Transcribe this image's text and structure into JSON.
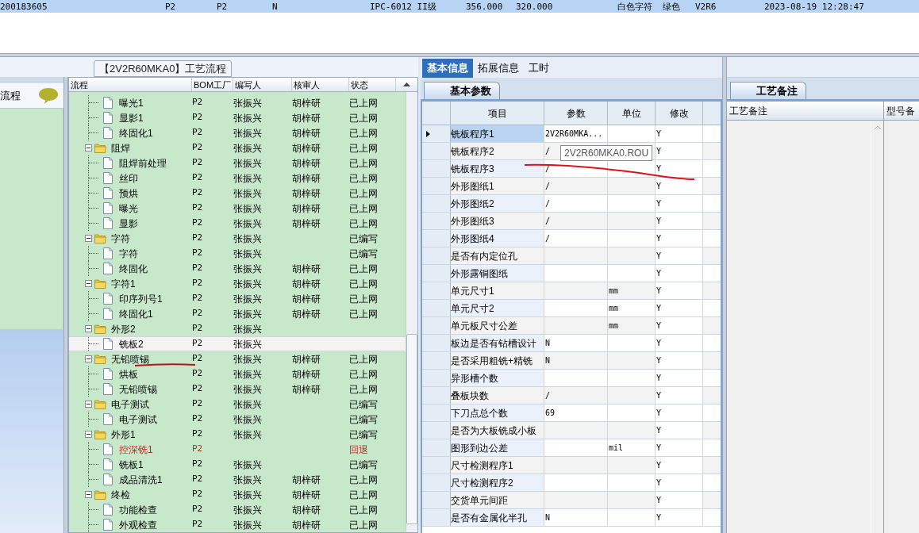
{
  "top_row": {
    "selected": true,
    "cells": [
      "200183605",
      "P2",
      "P2",
      "N",
      "IPC-6012 II级",
      "356.000",
      "320.000",
      "白色字符",
      "绿色",
      "V2R6",
      "2023-08-19 12:28:47"
    ]
  },
  "process_panel": {
    "title": "【2V2R60MKA0】工艺流程",
    "nav_item": "流程",
    "columns": [
      "流程",
      "BOM工厂",
      "编写人",
      "核审人",
      "状态"
    ],
    "groups": [
      {
        "children": [
          {
            "label": "曝光1",
            "factory": "P2",
            "writer": "张振兴",
            "reviewer": "胡梓研",
            "status": "已上网",
            "returned": false,
            "selected": false
          },
          {
            "label": "显影1",
            "factory": "P2",
            "writer": "张振兴",
            "reviewer": "胡梓研",
            "status": "已上网",
            "returned": false,
            "selected": false
          },
          {
            "label": "终固化1",
            "factory": "P2",
            "writer": "张振兴",
            "reviewer": "胡梓研",
            "status": "已上网",
            "returned": false,
            "selected": false
          }
        ]
      },
      {
        "label": "阻焊",
        "factory": "P2",
        "writer": "张振兴",
        "reviewer": "胡梓研",
        "status": "已上网",
        "expanded": true,
        "children": [
          {
            "label": "阻焊前处理",
            "factory": "P2",
            "writer": "张振兴",
            "reviewer": "胡梓研",
            "status": "已上网",
            "returned": false,
            "selected": false
          },
          {
            "label": "丝印",
            "factory": "P2",
            "writer": "张振兴",
            "reviewer": "胡梓研",
            "status": "已上网",
            "returned": false,
            "selected": false
          },
          {
            "label": "预烘",
            "factory": "P2",
            "writer": "张振兴",
            "reviewer": "胡梓研",
            "status": "已上网",
            "returned": false,
            "selected": false
          },
          {
            "label": "曝光",
            "factory": "P2",
            "writer": "张振兴",
            "reviewer": "胡梓研",
            "status": "已上网",
            "returned": false,
            "selected": false
          },
          {
            "label": "显影",
            "factory": "P2",
            "writer": "张振兴",
            "reviewer": "胡梓研",
            "status": "已上网",
            "returned": false,
            "selected": false
          }
        ]
      },
      {
        "label": "字符",
        "factory": "P2",
        "writer": "张振兴",
        "status": "已编写",
        "expanded": true,
        "children": [
          {
            "label": "字符",
            "factory": "P2",
            "writer": "张振兴",
            "status": "已编写",
            "returned": false,
            "selected": false
          },
          {
            "label": "终固化",
            "factory": "P2",
            "writer": "张振兴",
            "reviewer": "胡梓研",
            "status": "已上网",
            "returned": false,
            "selected": false
          }
        ]
      },
      {
        "label": "字符1",
        "factory": "P2",
        "writer": "张振兴",
        "reviewer": "胡梓研",
        "status": "已上网",
        "expanded": true,
        "children": [
          {
            "label": "印序列号1",
            "factory": "P2",
            "writer": "张振兴",
            "reviewer": "胡梓研",
            "status": "已上网",
            "returned": false,
            "selected": false
          },
          {
            "label": "终固化1",
            "factory": "P2",
            "writer": "张振兴",
            "reviewer": "胡梓研",
            "status": "已上网",
            "returned": false,
            "selected": false
          }
        ]
      },
      {
        "label": "外形2",
        "factory": "P2",
        "writer": "张振兴",
        "expanded": true,
        "children": [
          {
            "label": "铣板2",
            "factory": "P2",
            "writer": "张振兴",
            "returned": false,
            "selected": true
          }
        ]
      },
      {
        "label": "无铅喷锡",
        "factory": "P2",
        "writer": "张振兴",
        "reviewer": "胡梓研",
        "status": "已上网",
        "expanded": true,
        "children": [
          {
            "label": "烘板",
            "factory": "P2",
            "writer": "张振兴",
            "reviewer": "胡梓研",
            "status": "已上网",
            "returned": false,
            "selected": false
          },
          {
            "label": "无铅喷锡",
            "factory": "P2",
            "writer": "张振兴",
            "reviewer": "胡梓研",
            "status": "已上网",
            "returned": false,
            "selected": false
          }
        ]
      },
      {
        "label": "电子测试",
        "factory": "P2",
        "writer": "张振兴",
        "status": "已编写",
        "expanded": true,
        "children": [
          {
            "label": "电子测试",
            "factory": "P2",
            "writer": "张振兴",
            "status": "已编写",
            "returned": false,
            "selected": false
          }
        ]
      },
      {
        "label": "外形1",
        "factory": "P2",
        "writer": "张振兴",
        "status": "已编写",
        "expanded": true,
        "children": [
          {
            "label": "控深铣1",
            "factory": "P2",
            "status": "回退",
            "returned": true,
            "selected": false
          },
          {
            "label": "铣板1",
            "factory": "P2",
            "writer": "张振兴",
            "status": "已编写",
            "returned": false,
            "selected": false
          },
          {
            "label": "成品清洗1",
            "factory": "P2",
            "writer": "张振兴",
            "reviewer": "胡梓研",
            "status": "已上网",
            "returned": false,
            "selected": false
          }
        ]
      },
      {
        "label": "终检",
        "factory": "P2",
        "writer": "张振兴",
        "reviewer": "胡梓研",
        "status": "已上网",
        "expanded": true,
        "children": [
          {
            "label": "功能检查",
            "factory": "P2",
            "writer": "张振兴",
            "reviewer": "胡梓研",
            "status": "已上网",
            "returned": false,
            "selected": false
          },
          {
            "label": "外观检查",
            "factory": "P2",
            "writer": "张振兴",
            "reviewer": "胡梓研",
            "status": "已上网",
            "returned": false,
            "selected": false
          }
        ]
      }
    ]
  },
  "detail": {
    "tabs": [
      {
        "label": "基本信息",
        "selected": true
      },
      {
        "label": "拓展信息",
        "selected": false
      },
      {
        "label": "工时",
        "selected": false
      }
    ],
    "subtab": "基本参数",
    "columns": [
      "项目",
      "参数",
      "单位",
      "修改"
    ],
    "tooltip": "2V2R60MKA0.ROU",
    "rows": [
      {
        "item": "铣板程序1",
        "param": "2V2R60MKA...",
        "modify": "Y",
        "current": true
      },
      {
        "item": "铣板程序2",
        "param": "/",
        "modify": "Y",
        "current": false
      },
      {
        "item": "铣板程序3",
        "param": "/",
        "modify": "Y",
        "current": false
      },
      {
        "item": "外形图纸1",
        "param": "/",
        "modify": "Y",
        "current": false
      },
      {
        "item": "外形图纸2",
        "param": "/",
        "modify": "Y",
        "current": false
      },
      {
        "item": "外形图纸3",
        "param": "/",
        "modify": "Y",
        "current": false
      },
      {
        "item": "外形图纸4",
        "param": "/",
        "modify": "Y",
        "current": false
      },
      {
        "item": "是否有内定位孔",
        "modify": "Y",
        "current": false
      },
      {
        "item": "外形露铜图纸",
        "modify": "Y",
        "current": false
      },
      {
        "item": "单元尺寸1",
        "unit": "mm",
        "modify": "Y",
        "current": false
      },
      {
        "item": "单元尺寸2",
        "unit": "mm",
        "modify": "Y",
        "current": false
      },
      {
        "item": "单元板尺寸公差",
        "unit": "mm",
        "modify": "Y",
        "current": false
      },
      {
        "item": "板边是否有钻槽设计",
        "param": "N",
        "modify": "Y",
        "current": false
      },
      {
        "item": "是否采用粗铣+精铣",
        "param": "N",
        "modify": "Y",
        "current": false
      },
      {
        "item": "异形槽个数",
        "modify": "Y",
        "current": false
      },
      {
        "item": "叠板块数",
        "param": "/",
        "modify": "Y",
        "current": false
      },
      {
        "item": "下刀点总个数",
        "param": "69",
        "modify": "Y",
        "current": false
      },
      {
        "item": "是否为大板铣成小板",
        "modify": "Y",
        "current": false
      },
      {
        "item": "图形到边公差",
        "unit": "mil",
        "modify": "Y",
        "current": false
      },
      {
        "item": "尺寸检测程序1",
        "modify": "Y",
        "current": false
      },
      {
        "item": "尺寸检测程序2",
        "modify": "Y",
        "current": false
      },
      {
        "item": "交货单元间距",
        "modify": "Y",
        "current": false
      },
      {
        "item": "是否有金属化半孔",
        "param": "N",
        "modify": "Y",
        "current": false
      }
    ]
  },
  "notes": {
    "tab": "工艺备注",
    "columns": [
      "工艺备注",
      "型号备"
    ]
  }
}
